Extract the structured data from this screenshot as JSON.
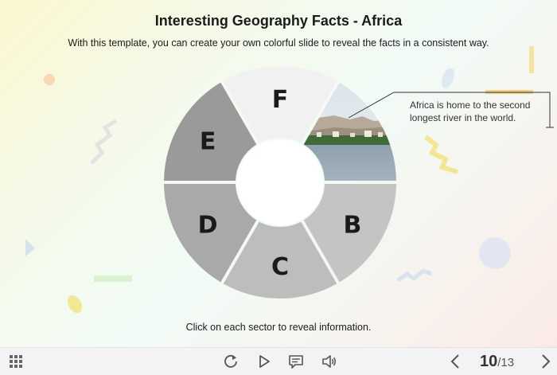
{
  "slide": {
    "title": "Interesting Geography Facts - Africa",
    "subtitle": "With this template, you can create your own colorful slide to reveal the facts in a consistent way.",
    "instruction": "Click on each sector to reveal information."
  },
  "wheel": {
    "sectors": [
      {
        "letter": "B",
        "color": "#c4c4c4"
      },
      {
        "letter": "C",
        "color": "#bdbdbd"
      },
      {
        "letter": "D",
        "color": "#a9a9a9"
      },
      {
        "letter": "E",
        "color": "#9a9a9a"
      },
      {
        "letter": "F",
        "color": "#f1f1f1"
      }
    ],
    "revealed_sector": "A",
    "revealed_image": "nile-river-photo"
  },
  "callout": {
    "text": "Africa is home to the second longest river in the world."
  },
  "player": {
    "current_page": "10",
    "total_pages": "/13",
    "icons": {
      "menu": "grid-icon",
      "replay": "replay-icon",
      "play": "play-icon",
      "captions": "captions-icon",
      "volume": "volume-icon",
      "prev": "chevron-left-icon",
      "next": "chevron-right-icon"
    }
  }
}
